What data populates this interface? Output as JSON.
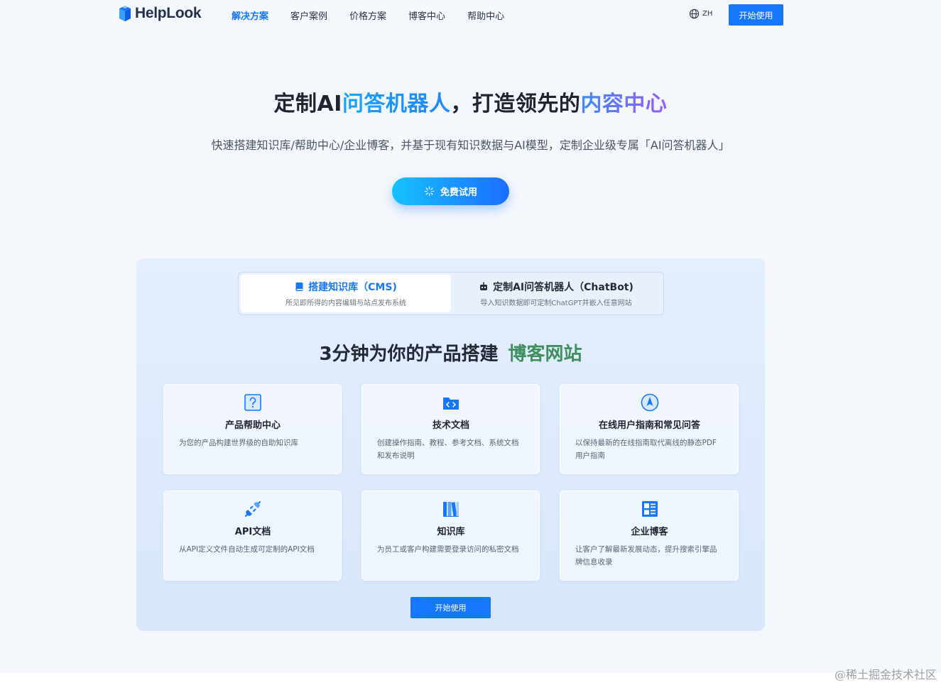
{
  "header": {
    "logo_text": "HelpLook",
    "nav": [
      {
        "label": "解决方案",
        "active": true
      },
      {
        "label": "客户案例",
        "active": false
      },
      {
        "label": "价格方案",
        "active": false
      },
      {
        "label": "博客中心",
        "active": false
      },
      {
        "label": "帮助中心",
        "active": false
      }
    ],
    "lang_label": "ZH",
    "start_label": "开始使用"
  },
  "hero": {
    "title_part1": "定制AI",
    "title_part2": "问答机器人",
    "title_part3": "，打造领先的",
    "title_part4": "内容中心",
    "subtitle": "快速搭建知识库/帮助中心/企业博客，并基于现有知识数据与AI模型，定制企业级专属「AI问答机器人」",
    "trial_label": "免费试用"
  },
  "panel": {
    "tabs": [
      {
        "title": "搭建知识库（CMS)",
        "desc": "所见即所得的内容编辑与站点发布系统",
        "active": true
      },
      {
        "title": "定制AI问答机器人（ChatBot)",
        "desc": "导入知识数据即可定制ChatGPT并嵌入任意网站",
        "active": false
      }
    ],
    "title_main": "3分钟为你的产品搭建",
    "title_highlight": "博客网站",
    "cards": [
      {
        "icon": "question-icon",
        "title": "产品帮助中心",
        "desc": "为您的产品构建世界级的自助知识库"
      },
      {
        "icon": "code-folder-icon",
        "title": "技术文档",
        "desc": "创建操作指南、教程、参考文档、系统文档和发布说明"
      },
      {
        "icon": "compass-icon",
        "title": "在线用户指南和常见问答",
        "desc": "以保持最新的在线指南取代离线的静态PDF用户指南"
      },
      {
        "icon": "plug-icon",
        "title": "API文档",
        "desc": "从API定义文件自动生成可定制的API文档"
      },
      {
        "icon": "books-icon",
        "title": "知识库",
        "desc": "为员工或客户构建需要登录访问的私密文档"
      },
      {
        "icon": "blog-layout-icon",
        "title": "企业博客",
        "desc": "让客户了解最新发展动态，提升搜索引擎品牌信息收录"
      }
    ],
    "start_label": "开始使用"
  },
  "watermark": "@稀土掘金技术社区",
  "colors": {
    "accent": "#1677ff",
    "highlight_green": "#3f8f5f"
  }
}
